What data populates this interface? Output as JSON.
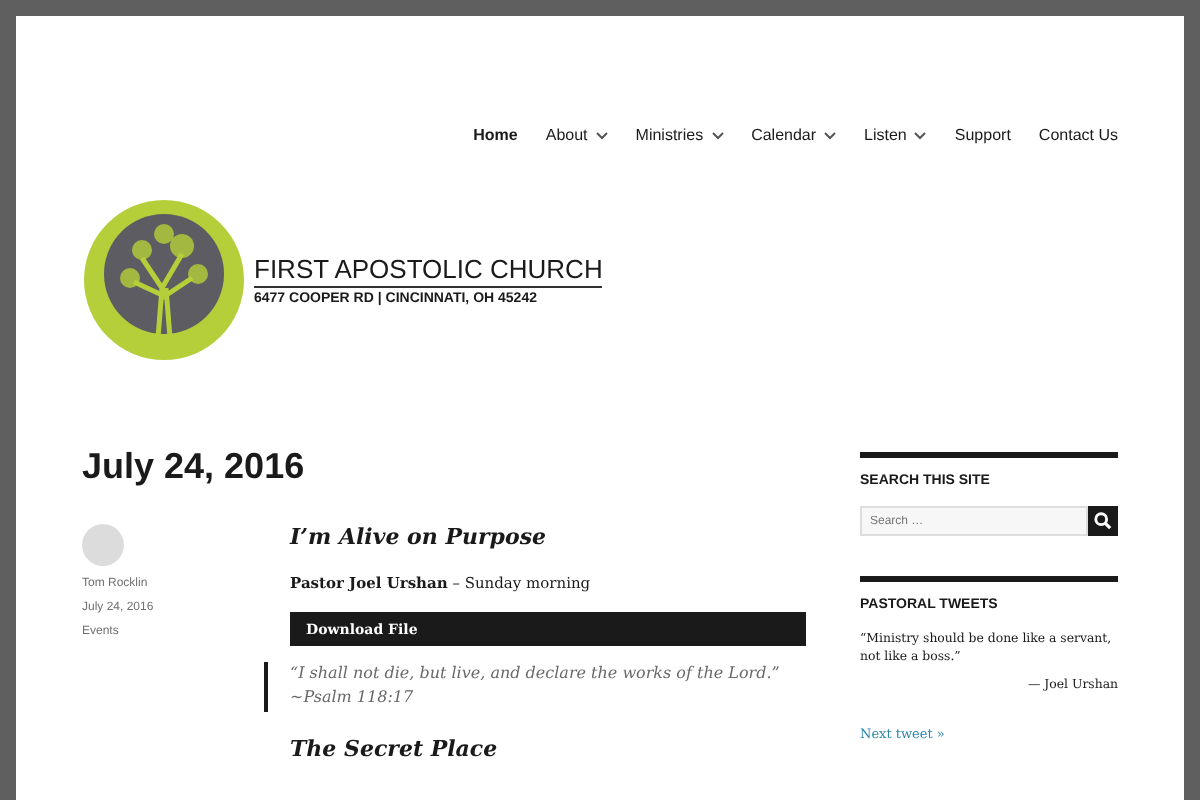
{
  "nav": [
    {
      "label": "Home",
      "selected": true,
      "dropdown": false
    },
    {
      "label": "About",
      "selected": false,
      "dropdown": true
    },
    {
      "label": "Ministries",
      "selected": false,
      "dropdown": true
    },
    {
      "label": "Calendar",
      "selected": false,
      "dropdown": true
    },
    {
      "label": "Listen",
      "selected": false,
      "dropdown": true
    },
    {
      "label": "Support",
      "selected": false,
      "dropdown": false
    },
    {
      "label": "Contact Us",
      "selected": false,
      "dropdown": false
    }
  ],
  "logo": {
    "name": "FIRST APOSTOLIC CHURCH",
    "address": "6477 COOPER RD | CINCINNATI, OH 45242"
  },
  "page_title": "July 24, 2016",
  "meta": [
    "Tom Rocklin",
    "July 24, 2016",
    "Events"
  ],
  "post": {
    "title": "I’m Alive on Purpose",
    "speaker": "Pastor Joel Urshan",
    "byline": " – Sunday morning",
    "download": "Download File",
    "quote": "“I shall not die, but live, and declare the works of the Lord.” ~Psalm 118:17",
    "next_title": "The Secret Place"
  },
  "sidebar": {
    "search_heading": "SEARCH THIS SITE",
    "search_placeholder": "Search …",
    "tweets_heading": "PASTORAL TWEETS",
    "tweet": "“Ministry should be done like a servant, not like a boss.”",
    "tweet_author": "— Joel Urshan",
    "next_link": "Next tweet »"
  }
}
